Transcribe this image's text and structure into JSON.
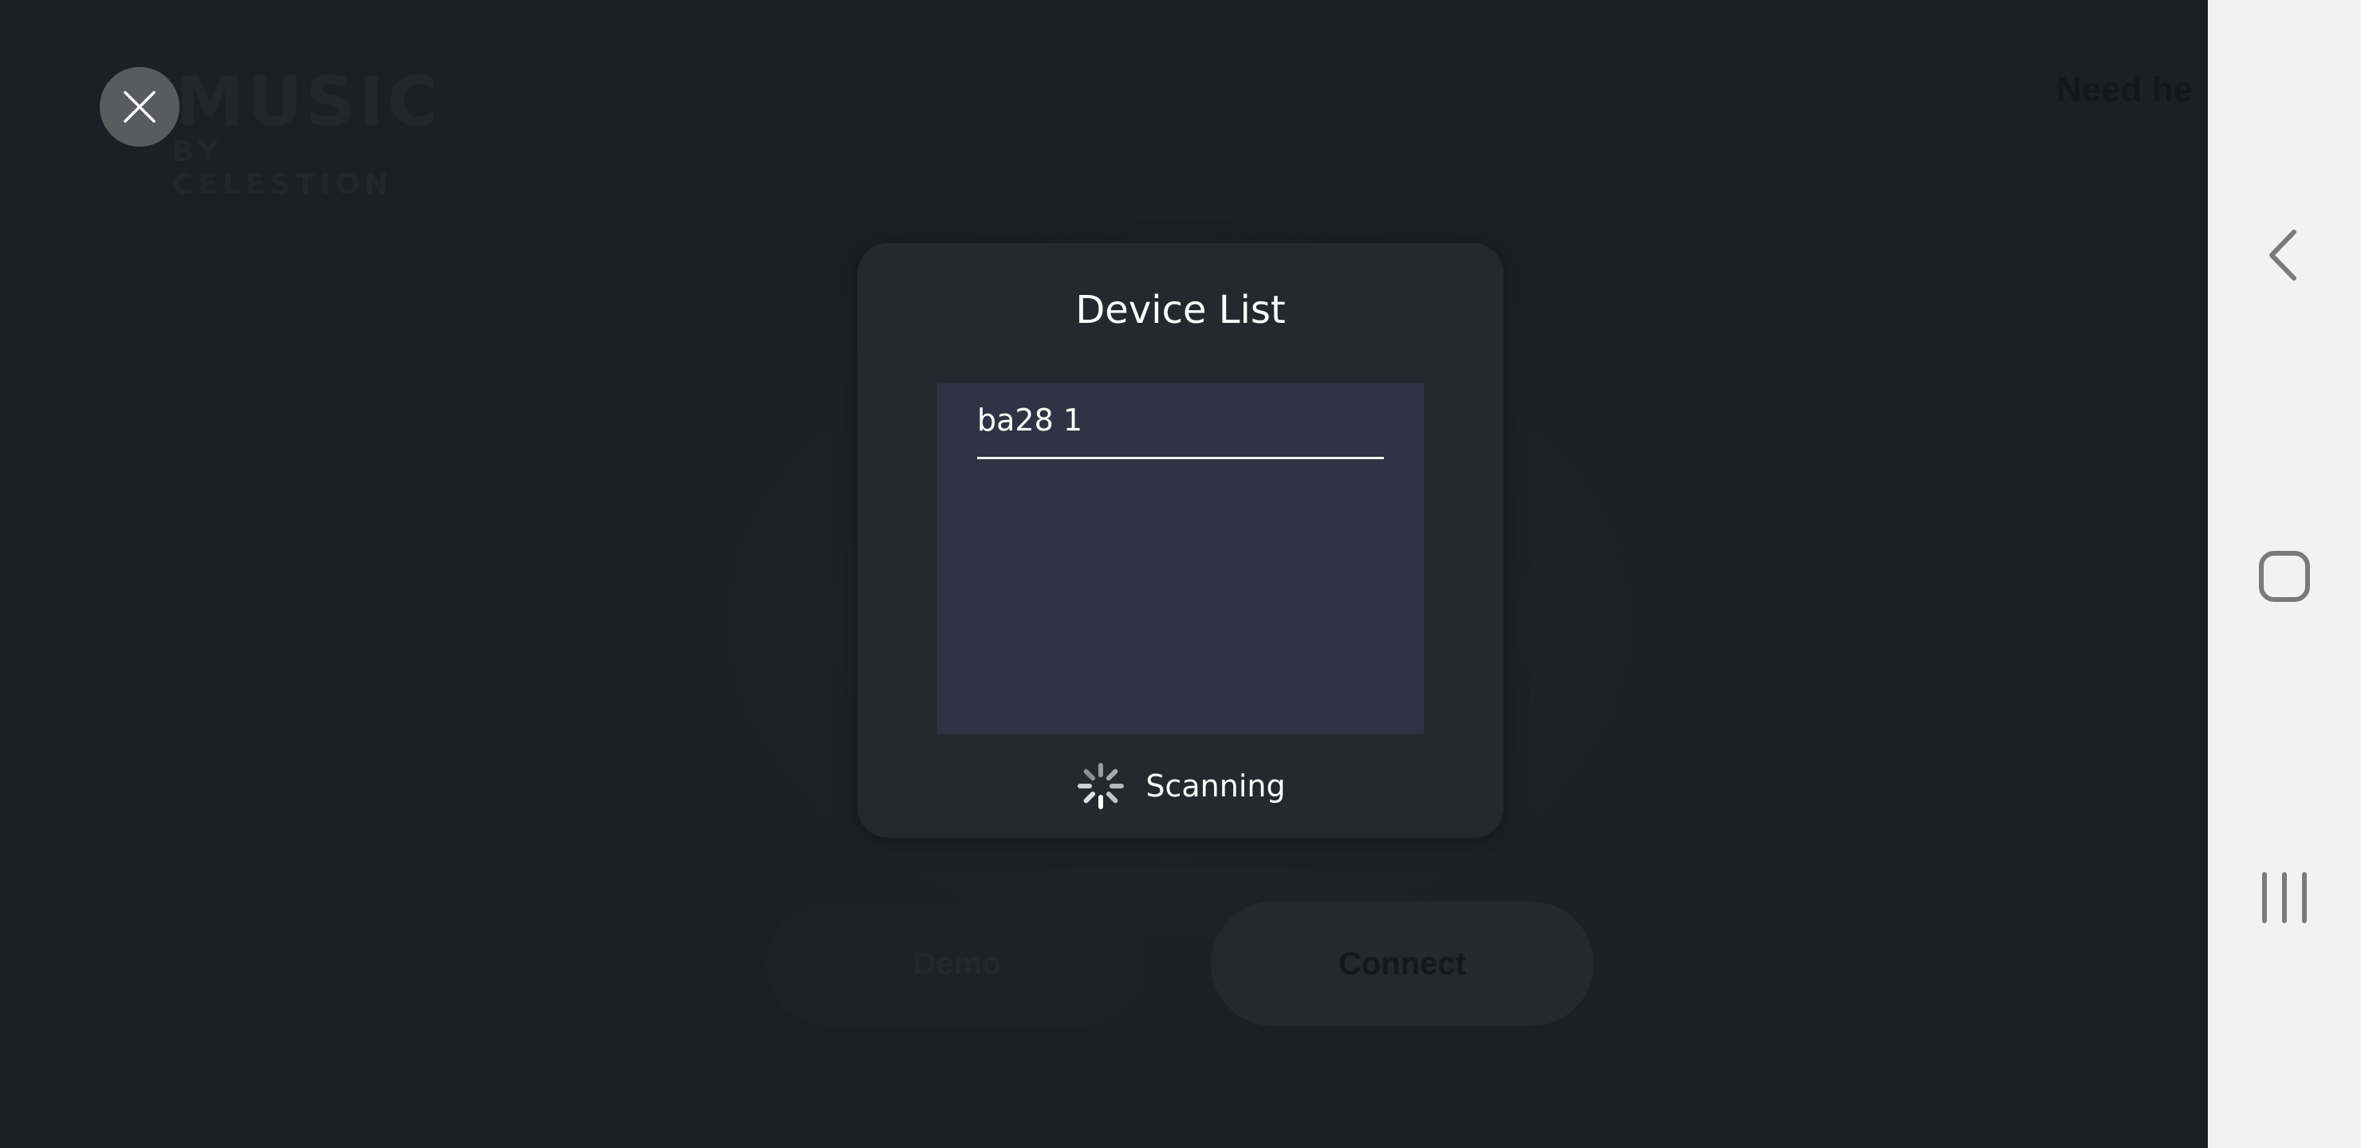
{
  "background_app": {
    "logo_main": "MUSIC",
    "logo_sub": "BY CELESTION",
    "help_link": "Need he",
    "demo_label": "Demo",
    "connect_label": "Connect"
  },
  "dialog": {
    "title": "Device List",
    "devices": [
      {
        "name": "ba28 1"
      }
    ],
    "status_text": "Scanning"
  },
  "icons": {
    "close": "close-icon",
    "spinner": "loading-spinner-icon",
    "back": "back-icon",
    "home": "home-icon",
    "recents": "recents-icon"
  },
  "colors": {
    "background": "#1d1f26",
    "dialog": "#262830",
    "list": "#313344",
    "navbar": "#f2f2f2"
  }
}
